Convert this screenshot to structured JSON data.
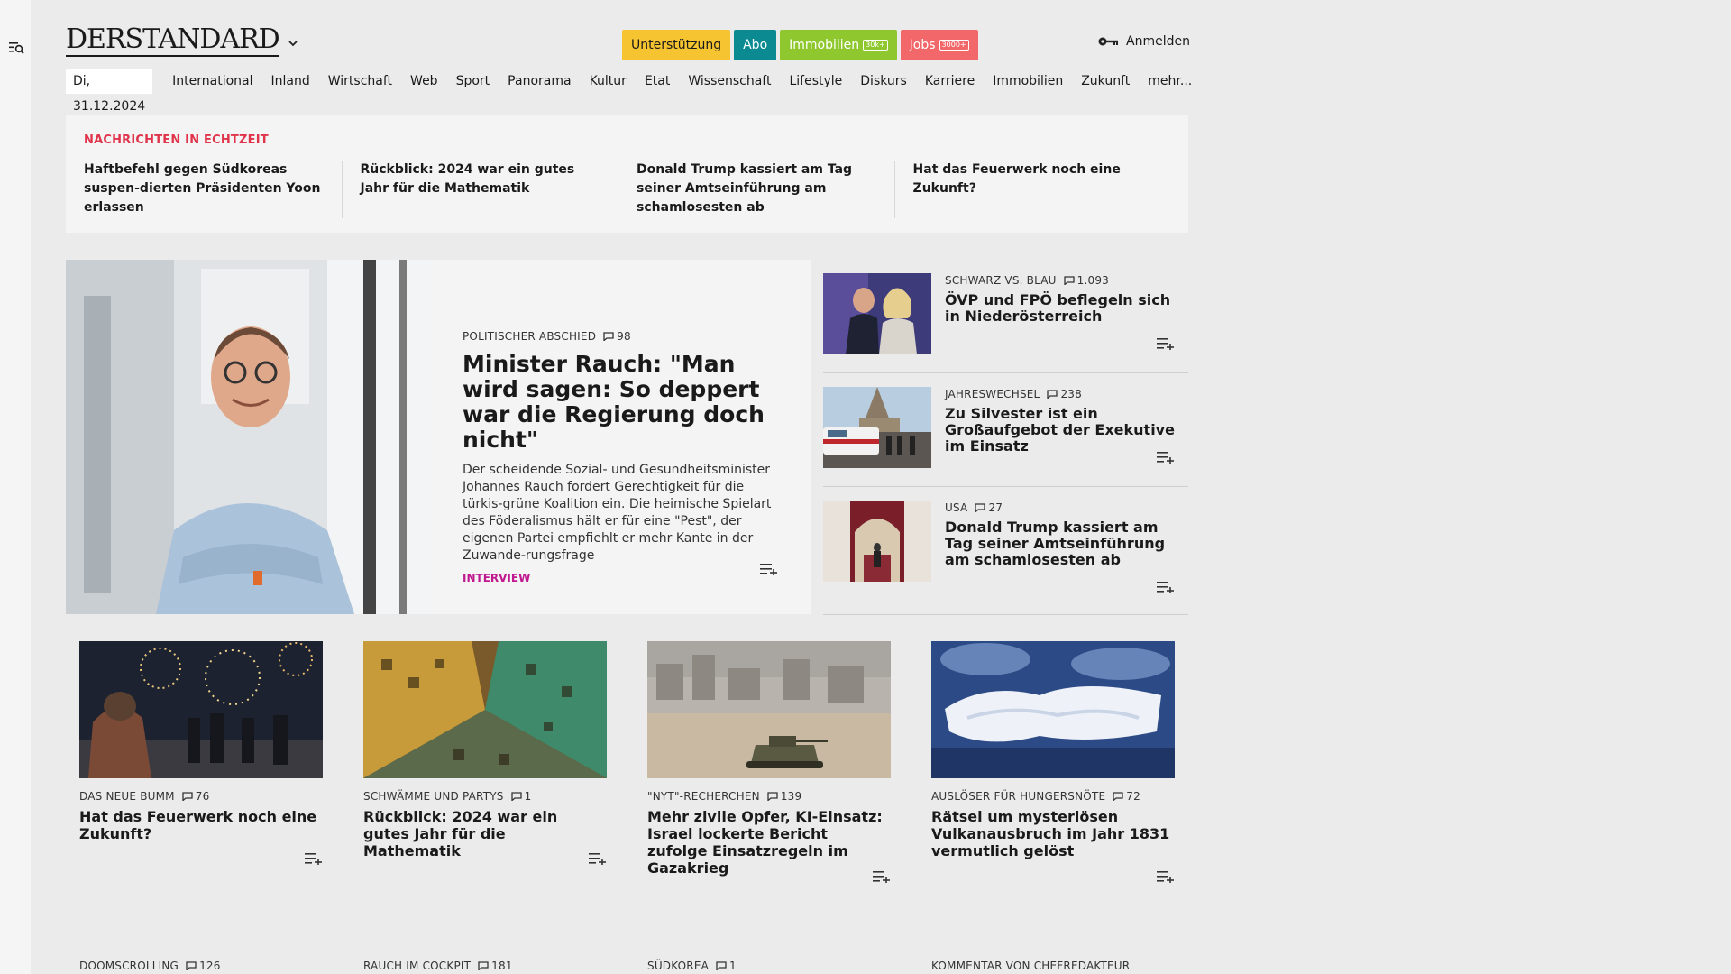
{
  "brand": {
    "logo_text": "DERSTANDARD"
  },
  "header": {
    "buttons": {
      "support": "Unterstützung",
      "abo": "Abo",
      "immobilien": "Immobilien",
      "immobilien_badge": "30k+",
      "jobs": "Jobs",
      "jobs_badge": "3000+"
    },
    "login": "Anmelden"
  },
  "nav": {
    "date": "Di, 31.12.2024",
    "items": [
      "International",
      "Inland",
      "Wirtschaft",
      "Web",
      "Sport",
      "Panorama",
      "Kultur",
      "Etat",
      "Wissenschaft",
      "Lifestyle",
      "Diskurs",
      "Karriere",
      "Immobilien",
      "Zukunft",
      "mehr..."
    ]
  },
  "live": {
    "label": "NACHRICHTEN IN ECHTZEIT",
    "items": [
      "Haftbefehl gegen Südkoreas suspen-dierten Präsidenten Yoon erlassen",
      "Rückblick: 2024 war ein gutes Jahr für die Mathematik",
      "Donald Trump kassiert am Tag seiner Amtseinführung am schamlosesten ab",
      "Hat das Feuerwerk noch eine Zukunft?"
    ]
  },
  "hero": {
    "kicker": "POLITISCHER ABSCHIED",
    "comments": "98",
    "title": "Minister Rauch: \"Man wird sagen: So deppert war die Regierung doch nicht\"",
    "lead": "Der scheidende Sozial- und Gesundheitsminister Johannes Rauch fordert Gerechtigkeit für die türkis-grüne Koalition ein. Die heimische Spielart des Föderalismus hält er für eine \"Pest\", der eigenen Partei empfiehlt er mehr Kante in der Zuwande-rungsfrage",
    "tag": "INTERVIEW"
  },
  "side": [
    {
      "kicker": "SCHWARZ VS. BLAU",
      "comments": "1.093",
      "title": "ÖVP und FPÖ beflegeln sich in Niederösterreich"
    },
    {
      "kicker": "JAHRESWECHSEL",
      "comments": "238",
      "title": "Zu Silvester ist ein Großaufgebot der Exekutive im Einsatz"
    },
    {
      "kicker": "USA",
      "comments": "27",
      "title": "Donald Trump kassiert am Tag seiner Amtseinführung am schamlosesten ab"
    }
  ],
  "cards": [
    {
      "kicker": "DAS NEUE BUMM",
      "comments": "76",
      "title": "Hat das Feuerwerk noch eine Zukunft?"
    },
    {
      "kicker": "SCHWÄMME UND PARTYS",
      "comments": "1",
      "title": "Rückblick: 2024 war ein gutes Jahr für die Mathematik"
    },
    {
      "kicker": "\"NYT\"-RECHERCHEN",
      "comments": "139",
      "title": "Mehr zivile Opfer, KI-Einsatz: Israel lockerte Bericht zufolge Einsatzregeln im Gazakrieg"
    },
    {
      "kicker": "AUSLÖSER FÜR HUNGERSNÖTE",
      "comments": "72",
      "title": "Rätsel um mysteriösen Vulkanausbruch im Jahr 1831 vermutlich gelöst"
    }
  ],
  "bottom": [
    {
      "kicker": "DOOMSCROLLING",
      "comments": "126"
    },
    {
      "kicker": "RAUCH IM COCKPIT",
      "comments": "181"
    },
    {
      "kicker": "SÜDKOREA",
      "comments": "1"
    },
    {
      "kicker": "KOMMENTAR VON CHEFREDAKTEUR",
      "comments": ""
    }
  ],
  "colors": {
    "live_label": "#e0344b",
    "interview_tag": "#c1178f",
    "support": "#f5c430",
    "abo": "#0b8b91",
    "immobilien": "#8fc82e",
    "jobs": "#f2686a"
  }
}
